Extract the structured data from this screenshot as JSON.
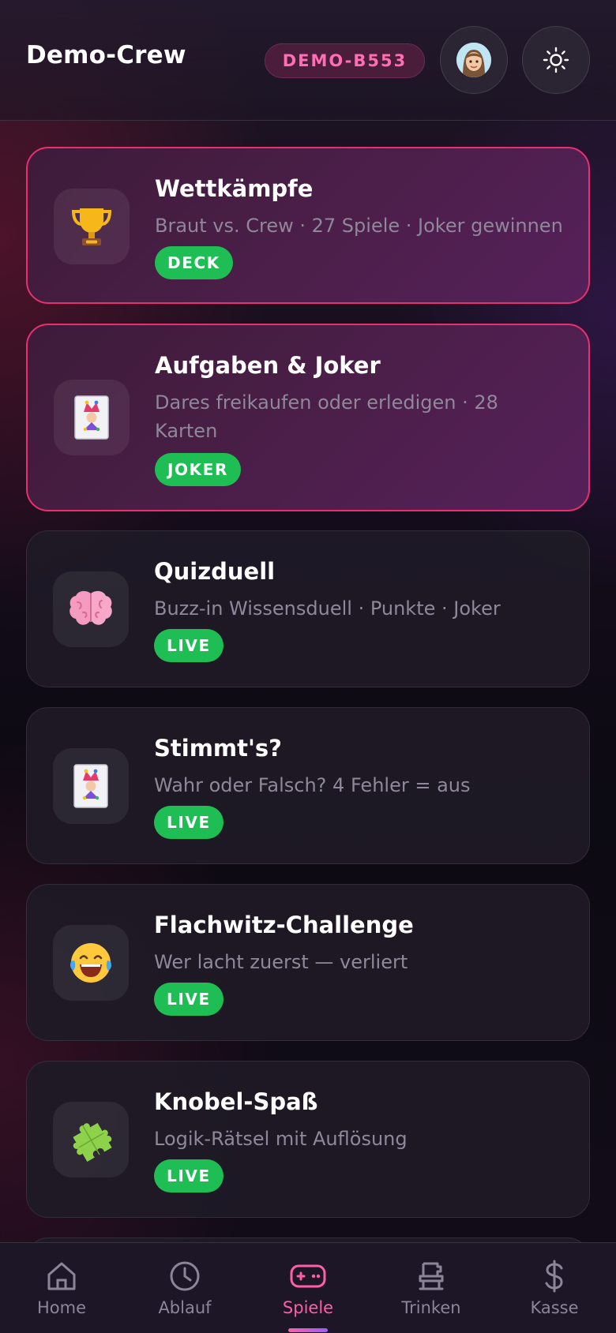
{
  "header": {
    "title": "Demo-Crew",
    "code": "DEMO-B553",
    "avatar_icon": "avatar-icon",
    "theme_icon": "sun-icon"
  },
  "games": [
    {
      "title": "Wettkämpfe",
      "subtitle": "Braut vs. Crew · 27 Spiele · Joker gewinnen",
      "badge": "DECK",
      "icon": "trophy-icon",
      "featured": true
    },
    {
      "title": "Aufgaben & Joker",
      "subtitle": "Dares freikaufen oder erledigen · 28 Karten",
      "badge": "JOKER",
      "icon": "joker-card-icon",
      "featured": true
    },
    {
      "title": "Quizduell",
      "subtitle": "Buzz-in Wissensduell · Punkte · Joker",
      "badge": "LIVE",
      "icon": "brain-icon",
      "featured": false
    },
    {
      "title": "Stimmt's?",
      "subtitle": "Wahr oder Falsch? 4 Fehler = aus",
      "badge": "LIVE",
      "icon": "joker-card-icon",
      "featured": false
    },
    {
      "title": "Flachwitz-Challenge",
      "subtitle": "Wer lacht zuerst — verliert",
      "badge": "LIVE",
      "icon": "laughing-face-icon",
      "featured": false
    },
    {
      "title": "Knobel-Spaß",
      "subtitle": "Logik-Rätsel mit Auflösung",
      "badge": "LIVE",
      "icon": "puzzle-icon",
      "featured": false
    }
  ],
  "nav": {
    "items": [
      {
        "label": "Home",
        "icon": "home-icon"
      },
      {
        "label": "Ablauf",
        "icon": "clock-icon"
      },
      {
        "label": "Spiele",
        "icon": "gamepad-icon"
      },
      {
        "label": "Trinken",
        "icon": "drink-icon"
      },
      {
        "label": "Kasse",
        "icon": "dollar-icon"
      }
    ],
    "active": "Spiele"
  },
  "colors": {
    "accent_pink": "#ff5ea8",
    "badge_green": "#1fbe55",
    "featured_border": "#e8306e"
  }
}
